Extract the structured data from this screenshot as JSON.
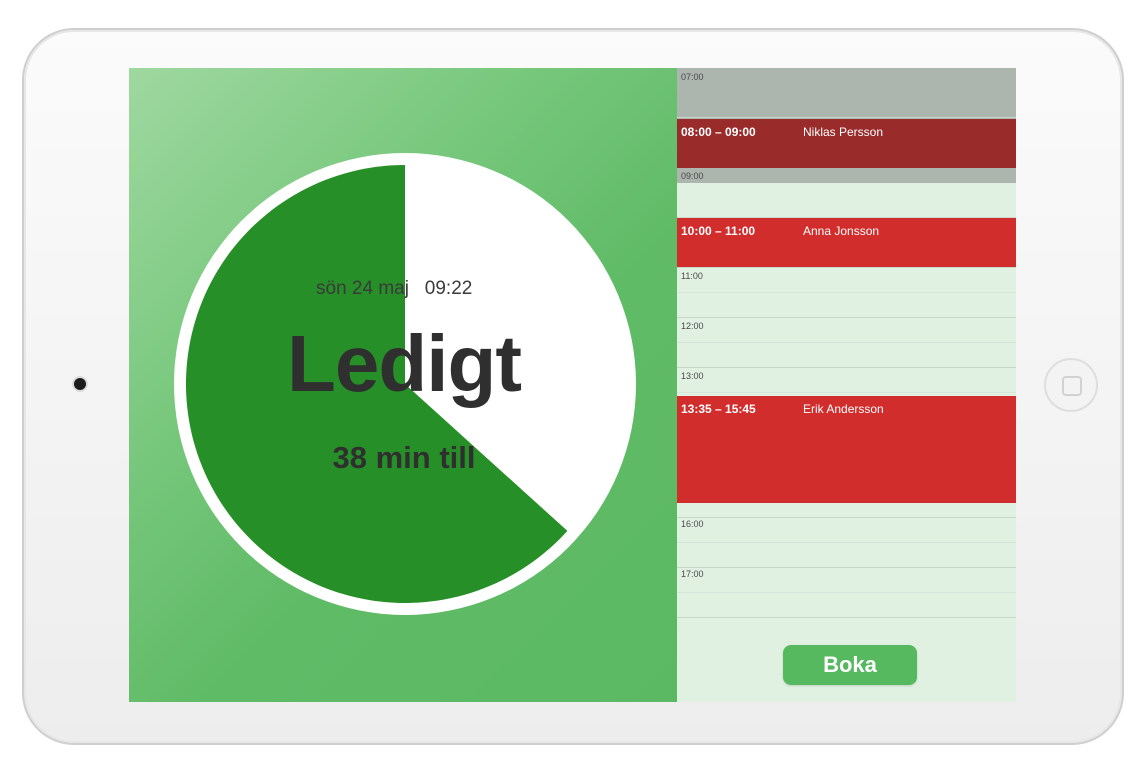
{
  "status": {
    "date": "sön 24 maj",
    "time": "09:22",
    "title": "Ledigt",
    "subtitle": "38 min till"
  },
  "calendar": {
    "hours": [
      "07:00",
      "09:00",
      "11:00",
      "12:00",
      "13:00",
      "16:00",
      "17:00"
    ],
    "events": [
      {
        "time": "08:00 – 09:00",
        "name": "Niklas Persson",
        "state": "past"
      },
      {
        "time": "10:00 – 11:00",
        "name": "Anna Jonsson",
        "state": "upcoming"
      },
      {
        "time": "13:35 – 15:45",
        "name": "Erik Andersson",
        "state": "upcoming"
      }
    ]
  },
  "actions": {
    "book_label": "Boka"
  },
  "colors": {
    "free_green": "#5cb963",
    "pie_dark_green": "#268f27",
    "event_red": "#d22d2d",
    "past_event_red": "#9a2b2b",
    "calendar_bg": "#e0f1e2"
  },
  "remaining_fraction_of_hour": 0.633
}
